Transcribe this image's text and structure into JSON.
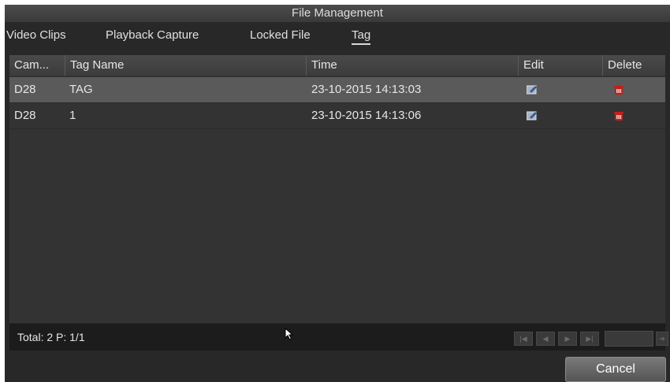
{
  "window": {
    "title": "File Management"
  },
  "tabs": [
    {
      "label": "Video Clips"
    },
    {
      "label": "Playback Capture"
    },
    {
      "label": "Locked File"
    },
    {
      "label": "Tag"
    }
  ],
  "active_tab": "Tag",
  "table": {
    "headers": {
      "camera": "Cam...",
      "tag_name": "Tag Name",
      "time": "Time",
      "edit": "Edit",
      "delete": "Delete"
    },
    "rows": [
      {
        "camera": "D28",
        "tag_name": "TAG",
        "time": "23-10-2015 14:13:03",
        "edit_icon": "edit-icon",
        "delete_icon": "trash-icon"
      },
      {
        "camera": "D28",
        "tag_name": "1",
        "time": "23-10-2015 14:13:06",
        "edit_icon": "edit-icon",
        "delete_icon": "trash-icon"
      }
    ]
  },
  "footer": {
    "total": "Total: 2 P: 1/1",
    "pager_icons": [
      "first-page-icon",
      "prev-page-icon",
      "next-page-icon",
      "last-page-icon",
      "go-page-icon"
    ]
  },
  "buttons": {
    "cancel": "Cancel"
  },
  "colors": {
    "background": "#282828",
    "selected_row": "#5a5a5a",
    "delete_icon": "#c0201a"
  }
}
